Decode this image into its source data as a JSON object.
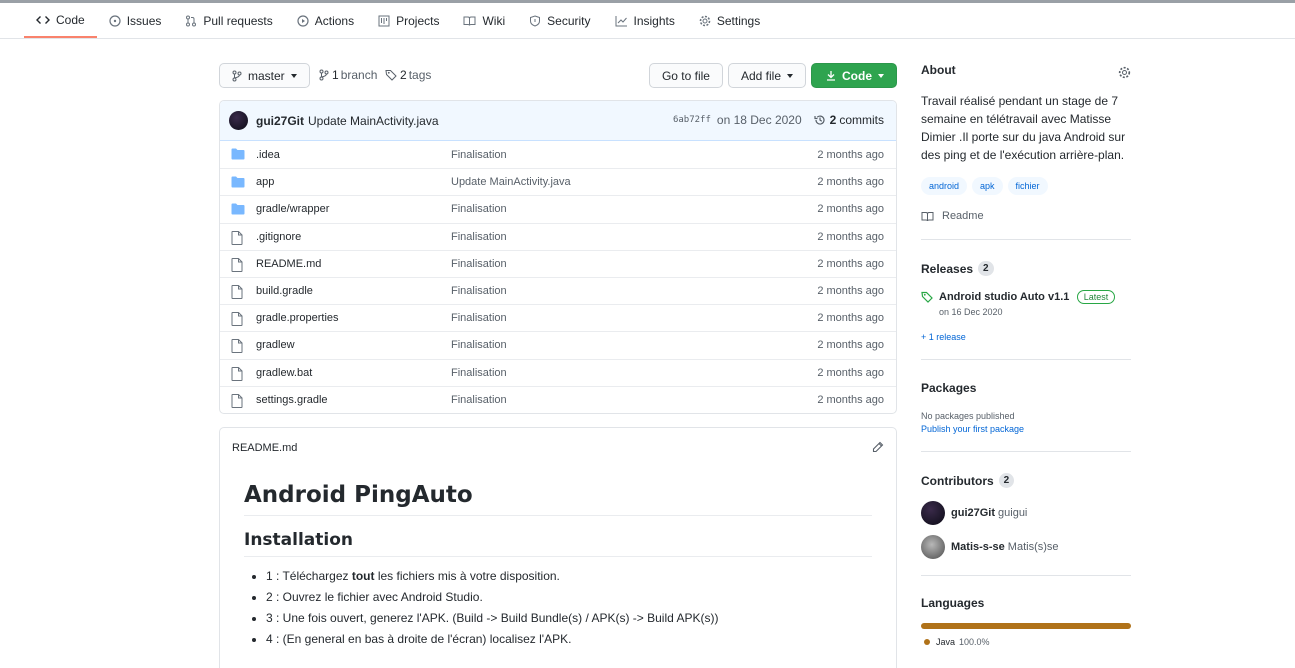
{
  "nav": {
    "tabs": [
      {
        "label": "Code",
        "icon": "code-icon"
      },
      {
        "label": "Issues",
        "icon": "issue-icon"
      },
      {
        "label": "Pull requests",
        "icon": "pull-request-icon"
      },
      {
        "label": "Actions",
        "icon": "play-icon"
      },
      {
        "label": "Projects",
        "icon": "project-icon"
      },
      {
        "label": "Wiki",
        "icon": "book-icon"
      },
      {
        "label": "Security",
        "icon": "shield-icon"
      },
      {
        "label": "Insights",
        "icon": "graph-icon"
      },
      {
        "label": "Settings",
        "icon": "gear-icon"
      }
    ]
  },
  "toolbar": {
    "branch": "master",
    "branch_count": "1",
    "branch_word": "branch",
    "tag_count": "2",
    "tag_word": "tags",
    "go_to_file": "Go to file",
    "add_file": "Add file",
    "code": "Code"
  },
  "commit": {
    "author": "gui27Git",
    "message": "Update MainActivity.java",
    "sha": "6ab72ff",
    "date": "on 18 Dec 2020",
    "count": "2",
    "count_word": "commits"
  },
  "files": [
    {
      "name": ".idea",
      "type": "dir",
      "message": "Finalisation",
      "age": "2 months ago"
    },
    {
      "name": "app",
      "type": "dir",
      "message": "Update MainActivity.java",
      "age": "2 months ago"
    },
    {
      "name": "gradle/wrapper",
      "type": "dir",
      "message": "Finalisation",
      "age": "2 months ago"
    },
    {
      "name": ".gitignore",
      "type": "file",
      "message": "Finalisation",
      "age": "2 months ago"
    },
    {
      "name": "README.md",
      "type": "file",
      "message": "Finalisation",
      "age": "2 months ago"
    },
    {
      "name": "build.gradle",
      "type": "file",
      "message": "Finalisation",
      "age": "2 months ago"
    },
    {
      "name": "gradle.properties",
      "type": "file",
      "message": "Finalisation",
      "age": "2 months ago"
    },
    {
      "name": "gradlew",
      "type": "file",
      "message": "Finalisation",
      "age": "2 months ago"
    },
    {
      "name": "gradlew.bat",
      "type": "file",
      "message": "Finalisation",
      "age": "2 months ago"
    },
    {
      "name": "settings.gradle",
      "type": "file",
      "message": "Finalisation",
      "age": "2 months ago"
    }
  ],
  "readme": {
    "filename": "README.md",
    "h1": "Android PingAuto",
    "h2": "Installation",
    "items": [
      {
        "before": "1 : Téléchargez ",
        "bold": "tout",
        "after": " les fichiers mis à votre disposition."
      },
      {
        "before": "2 : Ouvrez le fichier avec Android Studio.",
        "bold": "",
        "after": ""
      },
      {
        "before": "3 : Une fois ouvert, generez l'APK. (Build -> Build Bundle(s) / APK(s) -> Build APK(s))",
        "bold": "",
        "after": ""
      },
      {
        "before": "4 : (En general en bas à droite de l'écran) localisez l'APK.",
        "bold": "",
        "after": ""
      }
    ]
  },
  "about": {
    "title": "About",
    "description": "Travail réalisé pendant un stage de 7 semaine en télétravail avec Matisse Dimier .Il porte sur du java Android sur des ping et de l'exécution arrière-plan.",
    "topics": [
      "android",
      "apk",
      "fichier"
    ],
    "readme_link": "Readme"
  },
  "releases": {
    "title": "Releases",
    "count": "2",
    "latest_name": "Android studio Auto v1.1",
    "latest_badge": "Latest",
    "latest_date": "on 16 Dec 2020",
    "more": "+ 1 release"
  },
  "packages": {
    "title": "Packages",
    "none": "No packages published",
    "publish": "Publish your first package"
  },
  "contributors": {
    "title": "Contributors",
    "count": "2",
    "list": [
      {
        "login": "gui27Git",
        "name": "guigui"
      },
      {
        "login": "Matis-s-se",
        "name": "Matis(s)se"
      }
    ]
  },
  "languages": {
    "title": "Languages",
    "list": [
      {
        "name": "Java",
        "percent": "100.0%",
        "fraction": 1.0,
        "color": "#b07219"
      }
    ]
  },
  "colors": {
    "accent": "#0366d6",
    "green": "#2ea44f",
    "tab_underline": "#f9826c",
    "folder": "#79b8ff"
  }
}
